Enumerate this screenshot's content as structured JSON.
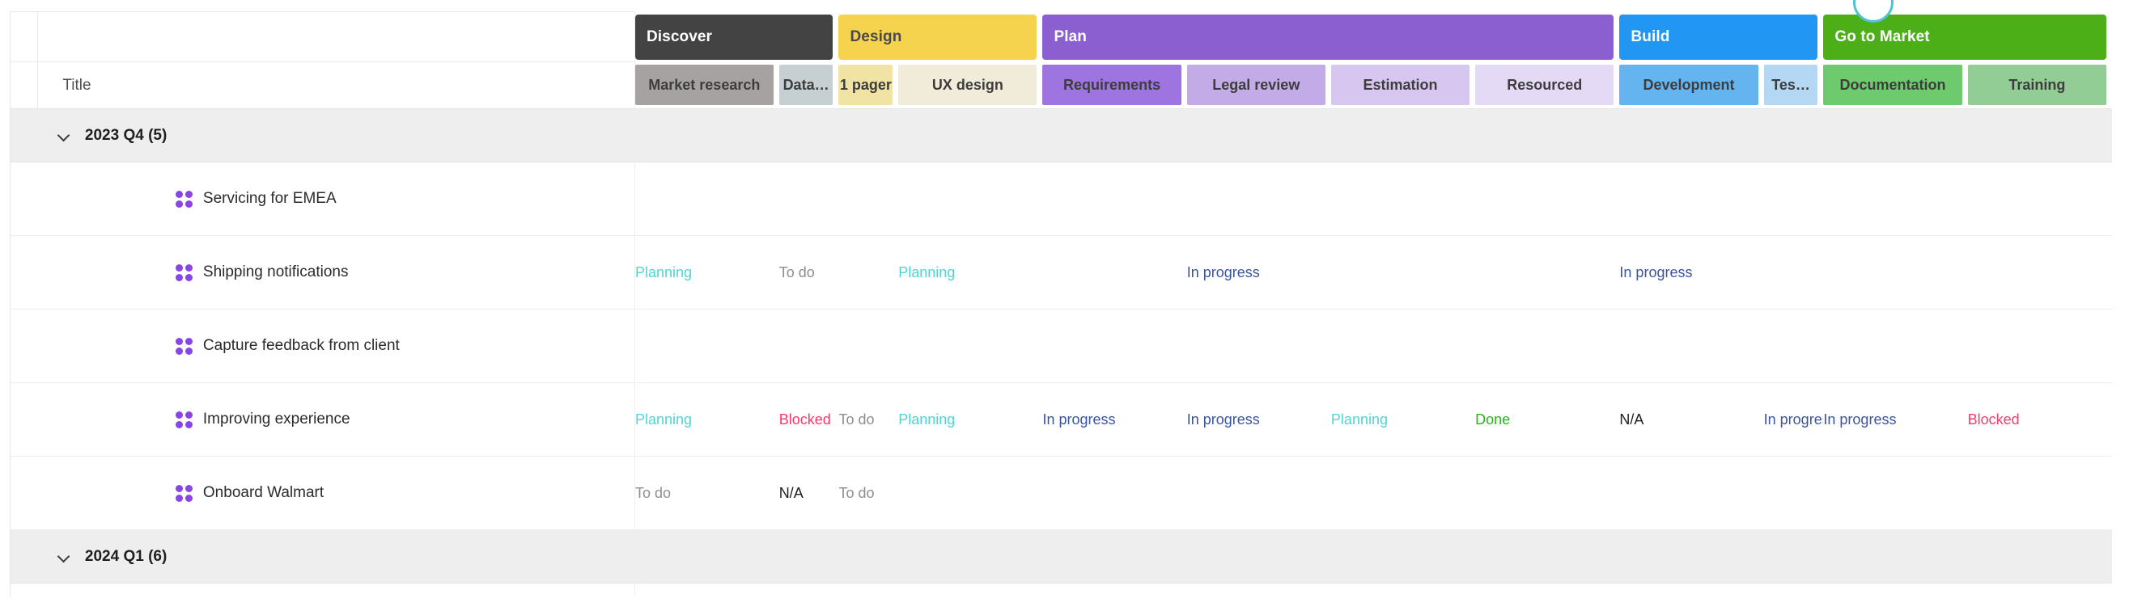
{
  "table": {
    "title_column_header": "Title",
    "phases": [
      {
        "label": "Discover",
        "color": "#434343",
        "text_color": "#ffffff",
        "span": 2
      },
      {
        "label": "Design",
        "color": "#f6d34f",
        "text_color": "#4a4a4a",
        "span": 2
      },
      {
        "label": "Plan",
        "color": "#8b5fcf",
        "text_color": "#ffffff",
        "span": 4
      },
      {
        "label": "Build",
        "color": "#2196f3",
        "text_color": "#ffffff",
        "span": 2
      },
      {
        "label": "Go to Market",
        "color": "#4caf17",
        "text_color": "#ffffff",
        "span": 2
      }
    ],
    "columns": [
      {
        "label": "Market research",
        "color": "#a6a2a2",
        "width": 145
      },
      {
        "label": "Data…",
        "color": "#c6cfd2",
        "width": 60
      },
      {
        "label": "1 pager",
        "color": "#f0e3a3",
        "width": 60
      },
      {
        "label": "UX design",
        "color": "#f1ecda",
        "width": 145
      },
      {
        "label": "Requirements",
        "color": "#9d74e0",
        "width": 145
      },
      {
        "label": "Legal review",
        "color": "#c3abe8",
        "width": 145
      },
      {
        "label": "Estimation",
        "color": "#d6c6f0",
        "width": 145
      },
      {
        "label": "Resourced",
        "color": "#e4daf6",
        "width": 145
      },
      {
        "label": "Development",
        "color": "#64b4ef",
        "width": 145
      },
      {
        "label": "Tes…",
        "color": "#b4d7f3",
        "width": 60
      },
      {
        "label": "Documentation",
        "color": "#6dcb6d",
        "width": 145
      },
      {
        "label": "Training",
        "color": "#92cd96",
        "width": 145
      }
    ],
    "status_colors": {
      "Planning": "#52d4cf",
      "To do": "#8e8e8e",
      "In progress": "#3b569e",
      "Blocked": "#f9386b",
      "Done": "#2bb11f",
      "N/A": "#1f1f1f"
    },
    "rows": [
      {
        "type": "group",
        "label": "2023 Q4 (5)",
        "expanded": true,
        "chevron_icon": "chevron-down-icon"
      },
      {
        "type": "task",
        "icon": "four-dots-icon",
        "label": "Servicing for EMEA",
        "values": [
          "",
          "",
          "",
          "",
          "",
          "",
          "",
          "",
          "",
          "",
          "",
          ""
        ]
      },
      {
        "type": "task",
        "icon": "four-dots-icon",
        "label": "Shipping notifications",
        "values": [
          "Planning",
          "To do",
          "",
          "Planning",
          "",
          "In progress",
          "",
          "",
          "In progress",
          "",
          "",
          ""
        ]
      },
      {
        "type": "task",
        "icon": "four-dots-icon",
        "label": "Capture feedback from client",
        "values": [
          "",
          "",
          "",
          "",
          "",
          "",
          "",
          "",
          "",
          "",
          "",
          ""
        ]
      },
      {
        "type": "task",
        "icon": "four-dots-icon",
        "label": "Improving experience",
        "values": [
          "Planning",
          "Blocked",
          "To do",
          "Planning",
          "In progress",
          "In progress",
          "Planning",
          "Done",
          "N/A",
          "In progress",
          "In progress",
          "Blocked"
        ]
      },
      {
        "type": "task",
        "icon": "four-dots-icon",
        "label": "Onboard Walmart",
        "values": [
          "To do",
          "N/A",
          "To do",
          "",
          "",
          "",
          "",
          "",
          "",
          "",
          "",
          ""
        ]
      },
      {
        "type": "group",
        "label": "2024 Q1 (6)",
        "expanded": true,
        "chevron_icon": "chevron-down-icon"
      }
    ]
  },
  "overlay": {
    "circle_indicator": {
      "icon": "circle-indicator-icon",
      "color": "#4dc4cf"
    }
  }
}
